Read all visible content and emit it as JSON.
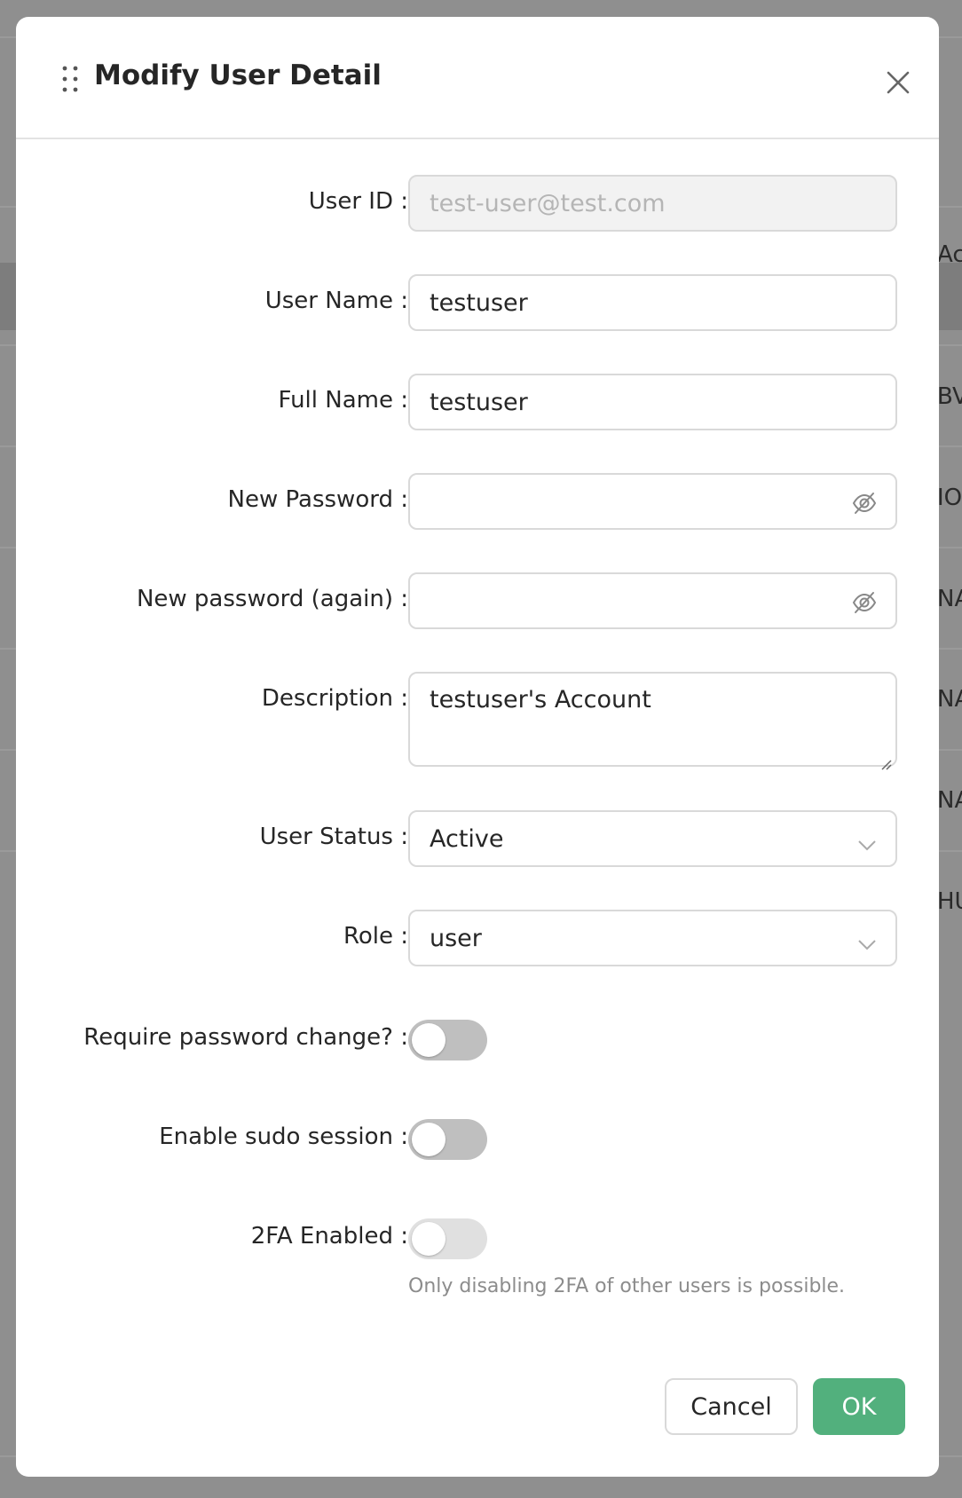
{
  "background": {
    "cells": [
      "Ac",
      "BV",
      "IO",
      "NA",
      "NA",
      "NA",
      "HU"
    ]
  },
  "modal": {
    "title": "Modify User Detail",
    "fields": {
      "user_id": {
        "label": "User ID :",
        "value": "test-user@test.com"
      },
      "user_name": {
        "label": "User Name :",
        "value": "testuser"
      },
      "full_name": {
        "label": "Full Name :",
        "value": "testuser"
      },
      "new_password": {
        "label": "New Password :",
        "value": ""
      },
      "new_password_again": {
        "label": "New password (again) :",
        "value": ""
      },
      "description": {
        "label": "Description :",
        "value": "testuser's Account"
      },
      "user_status": {
        "label": "User Status :",
        "value": "Active"
      },
      "role": {
        "label": "Role :",
        "value": "user"
      },
      "require_password_change": {
        "label": "Require password change? :",
        "enabled": false
      },
      "enable_sudo_session": {
        "label": "Enable sudo session :",
        "enabled": false
      },
      "two_fa_enabled": {
        "label": "2FA Enabled :",
        "enabled": false,
        "help": "Only disabling 2FA of other users is possible."
      }
    },
    "buttons": {
      "cancel": "Cancel",
      "ok": "OK"
    },
    "colors": {
      "primary": "#52b07d",
      "toggle_off": "#bfbfbf"
    }
  }
}
